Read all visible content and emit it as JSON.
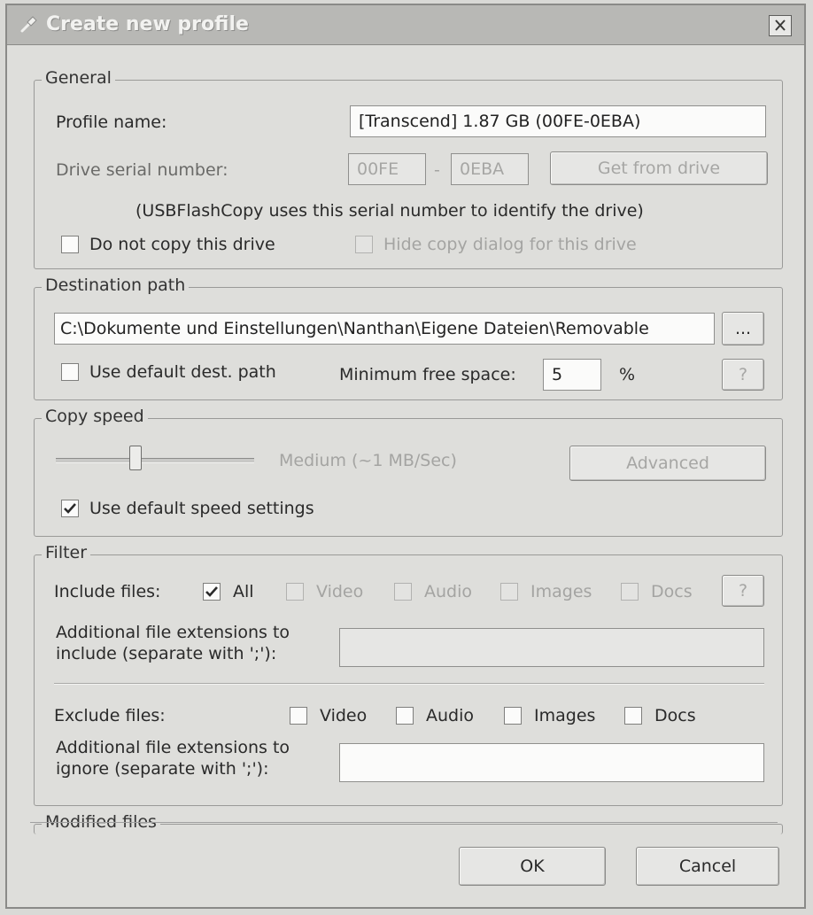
{
  "window": {
    "title": "Create new profile",
    "close_glyph": "✕"
  },
  "general": {
    "legend": "General",
    "profile_name_label": "Profile name:",
    "profile_name_value": "[Transcend] 1.87 GB (00FE-0EBA)",
    "serial_label": "Drive serial number:",
    "serial_part1": "00FE",
    "serial_dash": "-",
    "serial_part2": "0EBA",
    "get_from_drive_label": "Get from drive",
    "serial_note": "(USBFlashCopy uses this serial number to identify the drive)",
    "do_not_copy_label": "Do not copy this drive",
    "do_not_copy_checked": false,
    "hide_dialog_label": "Hide copy dialog for this drive",
    "hide_dialog_checked": false
  },
  "destination": {
    "legend": "Destination path",
    "path_value": "C:\\Dokumente und Einstellungen\\Nanthan\\Eigene Dateien\\Removable",
    "browse_label": "...",
    "use_default_label": "Use default dest. path",
    "use_default_checked": false,
    "min_free_label": "Minimum free space:",
    "min_free_value": "5",
    "percent_label": "%",
    "help_label": "?"
  },
  "copy_speed": {
    "legend": "Copy speed",
    "speed_text": "Medium (~1 MB/Sec)",
    "slider_position": 0.4,
    "advanced_label": "Advanced",
    "use_default_label": "Use default speed settings",
    "use_default_checked": true
  },
  "filter": {
    "legend": "Filter",
    "include_label": "Include files:",
    "include_options": [
      {
        "label": "All",
        "checked": true,
        "enabled": true
      },
      {
        "label": "Video",
        "checked": false,
        "enabled": false
      },
      {
        "label": "Audio",
        "checked": false,
        "enabled": false
      },
      {
        "label": "Images",
        "checked": false,
        "enabled": false
      },
      {
        "label": "Docs",
        "checked": false,
        "enabled": false
      }
    ],
    "help_label": "?",
    "include_ext_label_1": "Additional file extensions to",
    "include_ext_label_2": "include (separate with ';'):",
    "include_ext_value": "",
    "exclude_label": "Exclude files:",
    "exclude_options": [
      {
        "label": "Video",
        "checked": false
      },
      {
        "label": "Audio",
        "checked": false
      },
      {
        "label": "Images",
        "checked": false
      },
      {
        "label": "Docs",
        "checked": false
      }
    ],
    "exclude_ext_label_1": "Additional file extensions to",
    "exclude_ext_label_2": "ignore (separate with ';'):",
    "exclude_ext_value": ""
  },
  "modified_files": {
    "legend": "Modified files"
  },
  "footer": {
    "ok_label": "OK",
    "cancel_label": "Cancel"
  }
}
